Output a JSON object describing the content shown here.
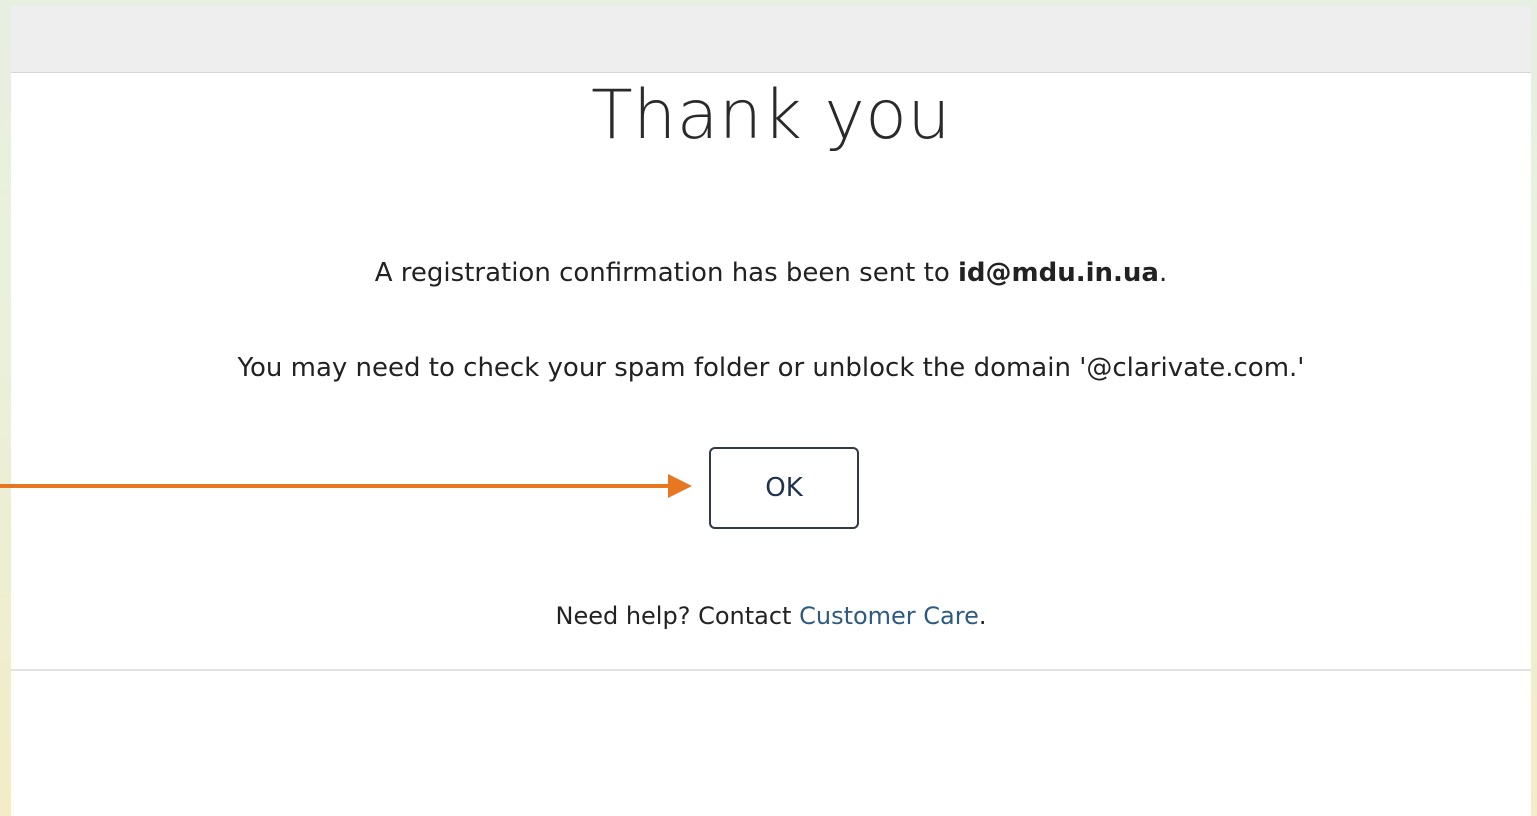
{
  "dialog": {
    "title": "Thank you",
    "confirmation": {
      "prefix": "A registration confirmation has been sent to ",
      "email": "id@mdu.in.ua",
      "suffix": "."
    },
    "spam_notice": "You may need to check your spam folder or unblock the domain '@clarivate.com.'",
    "ok_label": "OK",
    "help": {
      "prefix": "Need help? Contact ",
      "link_label": "Customer Care",
      "suffix": "."
    }
  },
  "annotation": {
    "arrow_color": "#e87722"
  }
}
